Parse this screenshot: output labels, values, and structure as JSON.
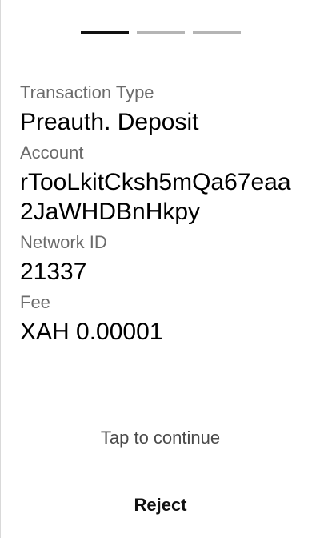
{
  "pager": {
    "pages": 3,
    "active_index": 0
  },
  "fields": [
    {
      "label": "Transaction Type",
      "value": "Preauth. Deposit"
    },
    {
      "label": "Account",
      "value": "rTooLkitCksh5mQa67eaa2JaWHDBnHkpy"
    },
    {
      "label": "Network ID",
      "value": "21337"
    },
    {
      "label": "Fee",
      "value": "XAH 0.00001"
    }
  ],
  "footer": {
    "tap_hint": "Tap to continue",
    "reject_label": "Reject"
  }
}
